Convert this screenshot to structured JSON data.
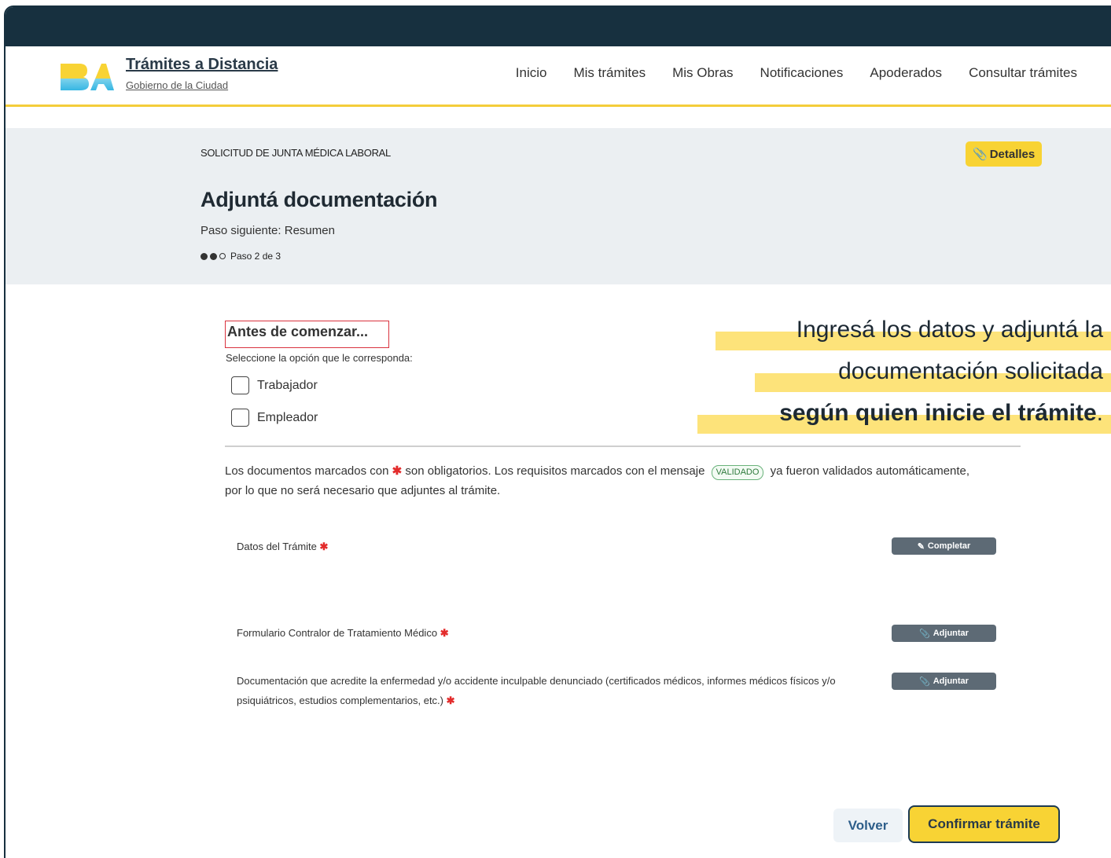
{
  "brand": {
    "title": "Trámites a Distancia",
    "subtitle": "Gobierno de la Ciudad",
    "colors": {
      "dark": "#17303f",
      "yellow": "#f8d334",
      "accent_line": "#f4cd3a"
    }
  },
  "nav": [
    "Inicio",
    "Mis trámites",
    "Mis Obras",
    "Notificaciones",
    "Apoderados",
    "Consultar trámites"
  ],
  "hero": {
    "kicker": "SOLICITUD DE JUNTA MÉDICA LABORAL",
    "details_label": "Detalles",
    "title": "Adjuntá documentación",
    "next_step": "Paso siguiente: Resumen",
    "step_text": "Paso 2 de 3",
    "step_current": 2,
    "step_total": 3
  },
  "callout": {
    "line1": "Ingresá los datos y adjuntá la",
    "line2": "documentación solicitada",
    "line3_bold": "según quien inicie el trámite",
    "line3_end": "."
  },
  "form": {
    "section_title": "Antes de comenzar...",
    "instruction": "Seleccione la opción que le corresponda:",
    "options": [
      "Trabajador",
      "Empleador"
    ],
    "legend_part1": "Los documentos marcados con",
    "legend_part2": "son obligatorios. Los requisitos marcados con el mensaje",
    "validated_badge": "VALIDADO",
    "legend_part3": "ya fueron validados automáticamente, por lo que no será necesario que adjuntes al trámite.",
    "requirements": [
      {
        "label": "Datos del Trámite",
        "button": "Completar"
      },
      {
        "label": "Formulario Contralor de Tratamiento Médico",
        "button": "Adjuntar"
      },
      {
        "label": "Documentación que acredite la enfermedad y/o accidente inculpable denunciado (certificados médicos, informes médicos físicos y/o psiquiátricos, estudios complementarios, etc.)",
        "button": "Adjuntar"
      }
    ]
  },
  "actions": {
    "back": "Volver",
    "confirm": "Confirmar trámite"
  }
}
